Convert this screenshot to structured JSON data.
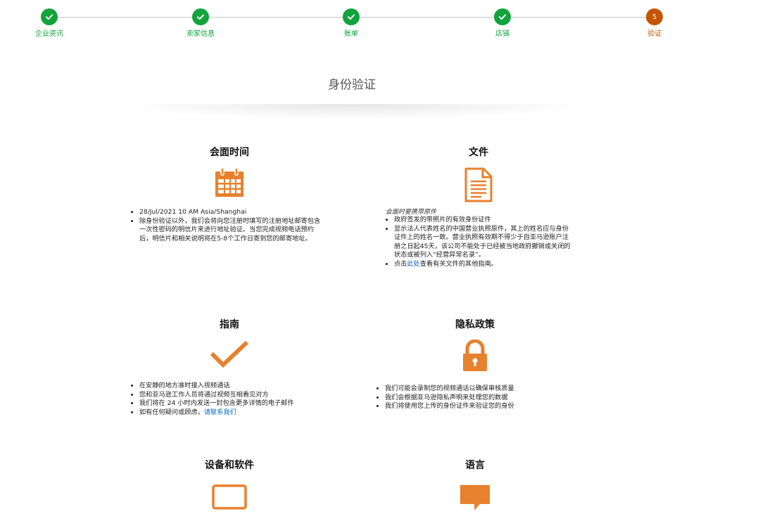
{
  "stepper": {
    "steps": [
      {
        "label": "企业资讯",
        "status": "done"
      },
      {
        "label": "卖家信息",
        "status": "done"
      },
      {
        "label": "账单",
        "status": "done"
      },
      {
        "label": "店铺",
        "status": "done"
      },
      {
        "label": "验证",
        "status": "current",
        "number": "5"
      }
    ]
  },
  "page": {
    "title": "身份验证"
  },
  "colors": {
    "done": "#12a33c",
    "current": "#c45500",
    "accent": "#e8812e",
    "link": "#0066c0"
  },
  "sections": {
    "meeting": {
      "title": "会面时间",
      "icon": "calendar-icon",
      "items": [
        "28/Jul/2021 10 AM Asia/Shanghai",
        "除身份验证以外，我们会将向您注册时填写的注册地址邮寄包含一次性密码的明信片来进行地址验证。当您完成视频电话预约后，明信片和相关说明将在5-8个工作日寄到您的邮寄地址。"
      ]
    },
    "documents": {
      "title": "文件",
      "icon": "document-icon",
      "note": "会面时要携带原件",
      "items": [
        "政府签发的带照片的有效身份证件",
        "显示法人代表姓名的中国营业执照原件，其上的姓名应与身份证件上的姓名一致。营业执照有效期不得少于自亚马逊账户注册之日起45天，该公司不能处于已经被当地政府撤销或关闭的状态或被列入“经营异常名录”。"
      ],
      "link_item": {
        "prefix": "点击",
        "link": "此处",
        "suffix": "查看有关文件的其他指南。"
      }
    },
    "guide": {
      "title": "指南",
      "icon": "checkmark-icon",
      "items": [
        "在安静的地方准时接入视频通话",
        "您和亚马逊工作人员将通过视频互相看见对方",
        "我们将在 24 小时内发送一封包含更多详情的电子邮件"
      ],
      "link_item": {
        "prefix": "如有任何疑问或顾虑，",
        "link": "请联系我们"
      }
    },
    "privacy": {
      "title": "隐私政策",
      "icon": "lock-icon",
      "items": [
        "我们可能会录制您的视频通话以确保审核质量",
        "我们会根据亚马逊隐私声明来处理您的数据",
        "我们将使用您上传的身份证件来验证您的身份"
      ]
    },
    "device": {
      "title": "设备和软件",
      "icon": "tablet-icon"
    },
    "language": {
      "title": "语言",
      "icon": "speech-bubble-icon"
    }
  }
}
